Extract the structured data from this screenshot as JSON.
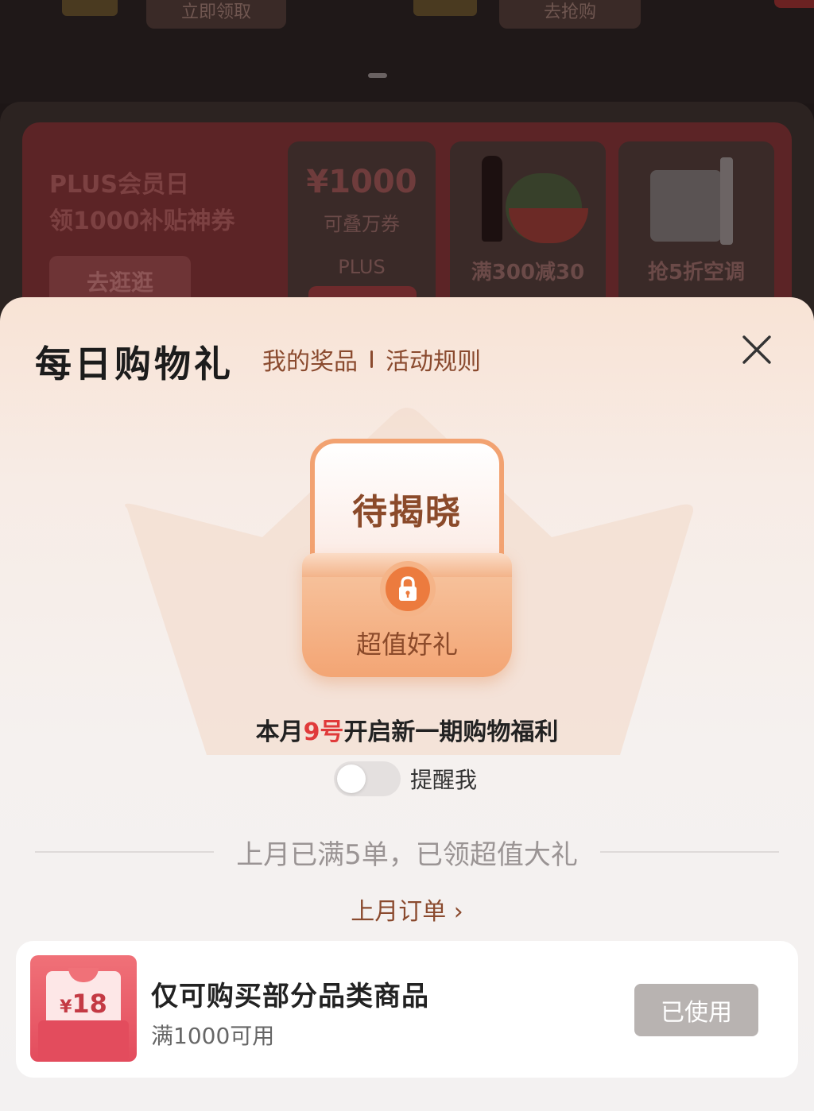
{
  "background": {
    "top_buttons": [
      "立即领取",
      "去抢购"
    ],
    "banner": {
      "title_line1": "PLUS会员日",
      "title_line2": "领1000补贴神券",
      "cta": "去逛逛",
      "coupon_amount": "¥1000",
      "coupon_desc": "可叠万券",
      "coupon_tag": "PLUS",
      "tile2_label": "满300减30",
      "tile3_label": "抢5折空调"
    }
  },
  "sheet": {
    "title": "每日购物礼",
    "links": [
      "我的奖品",
      "活动规则"
    ],
    "gift": {
      "title": "待揭晓",
      "subtitle": "超值好礼",
      "lock_icon": "lock-icon"
    },
    "notice": {
      "prefix": "本月",
      "highlight": "9号",
      "suffix": "开启新一期购物福利"
    },
    "remind": {
      "label": "提醒我",
      "enabled": false
    },
    "divider_text": "上月已满5单，已领超值大礼",
    "last_orders_link": "上月订单 ›",
    "coupon": {
      "amount": "18",
      "currency": "¥",
      "title": "仅可购买部分品类商品",
      "condition": "满1000可用",
      "button": "已使用"
    }
  },
  "colors": {
    "accent_brown": "#8a4a2e",
    "highlight_red": "#e03a3a",
    "gift_orange": "#f3a574",
    "coupon_red": "#e34c5d",
    "used_button_gray": "#b8b3b1"
  }
}
